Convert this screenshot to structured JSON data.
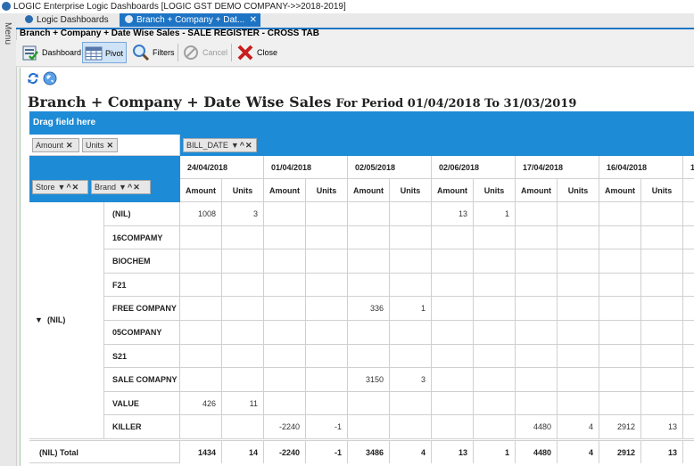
{
  "window": {
    "title": "LOGIC Enterprise  Logic Dashboards  [LOGIC GST DEMO COMPANY->>2018-2019]",
    "menu_label": "Menu"
  },
  "tabs": [
    {
      "label": "Logic Dashboards"
    },
    {
      "label": "Branch + Company + Dat...",
      "close": "✕"
    }
  ],
  "screen_title": "Branch + Company + Date Wise Sales - SALE REGISTER - CROSS TAB",
  "toolbar": {
    "dashboard": "Dashboard",
    "pivot": "Pivot",
    "filters": "Filters",
    "cancel": "Cancel",
    "close": "Close"
  },
  "report": {
    "title": "Branch + Company + Date Wise Sales",
    "period": "For Period 01/04/2018 To 31/03/2019"
  },
  "pivot": {
    "drag_hint": "Drag field here",
    "data_fields": [
      "Amount",
      "Units"
    ],
    "column_field": "BILL_DATE",
    "row_fields": [
      "Store",
      "Brand"
    ],
    "dates": [
      "24/04/2018",
      "01/04/2018",
      "02/05/2018",
      "02/06/2018",
      "17/04/2018",
      "16/04/2018",
      "1"
    ],
    "measures": [
      "Amount",
      "Units"
    ],
    "partial_measure": "A",
    "store": "(NIL)",
    "store_expander": "▼",
    "rows": [
      {
        "brand": "(NIL)",
        "cells": [
          "1008",
          "3",
          "",
          "",
          "",
          "",
          "13",
          "1",
          "",
          "",
          "",
          ""
        ]
      },
      {
        "brand": "16COMPAMY",
        "cells": [
          "",
          "",
          "",
          "",
          "",
          "",
          "",
          "",
          "",
          "",
          "",
          ""
        ]
      },
      {
        "brand": "BIOCHEM",
        "cells": [
          "",
          "",
          "",
          "",
          "",
          "",
          "",
          "",
          "",
          "",
          "",
          ""
        ]
      },
      {
        "brand": "F21",
        "cells": [
          "",
          "",
          "",
          "",
          "",
          "",
          "",
          "",
          "",
          "",
          "",
          ""
        ]
      },
      {
        "brand": "FREE COMPANY",
        "cells": [
          "",
          "",
          "",
          "",
          "336",
          "1",
          "",
          "",
          "",
          "",
          "",
          ""
        ]
      },
      {
        "brand": "05COMPANY",
        "cells": [
          "",
          "",
          "",
          "",
          "",
          "",
          "",
          "",
          "",
          "",
          "",
          ""
        ]
      },
      {
        "brand": "S21",
        "cells": [
          "",
          "",
          "",
          "",
          "",
          "",
          "",
          "",
          "",
          "",
          "",
          ""
        ]
      },
      {
        "brand": "SALE COMAPNY",
        "cells": [
          "",
          "",
          "",
          "",
          "3150",
          "3",
          "",
          "",
          "",
          "",
          "",
          ""
        ]
      },
      {
        "brand": "VALUE",
        "cells": [
          "426",
          "11",
          "",
          "",
          "",
          "",
          "",
          "",
          "",
          "",
          "",
          ""
        ]
      },
      {
        "brand": "KILLER",
        "cells": [
          "",
          "",
          "-2240",
          "-1",
          "",
          "",
          "",
          "",
          "4480",
          "4",
          "2912",
          "13"
        ]
      }
    ],
    "total_label": "(NIL) Total",
    "totals": [
      "1434",
      "14",
      "-2240",
      "-1",
      "3486",
      "4",
      "13",
      "1",
      "4480",
      "4",
      "2912",
      "13"
    ]
  },
  "colors": {
    "accent": "#1e8bd6",
    "tab_active": "#1e74c4"
  }
}
